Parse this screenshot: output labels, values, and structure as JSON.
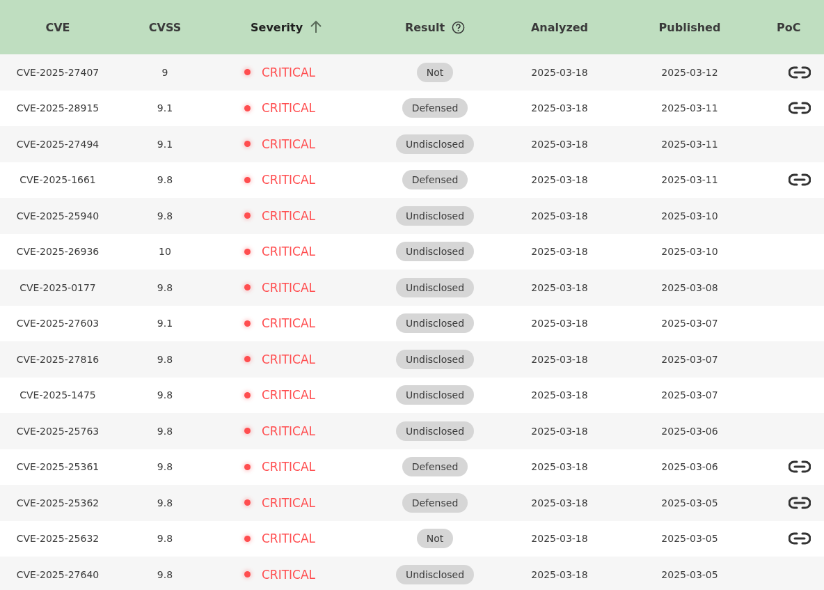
{
  "table": {
    "columns": [
      {
        "label": "CVE",
        "kind": "plain"
      },
      {
        "label": "CVSS",
        "kind": "plain"
      },
      {
        "label": "Severity",
        "kind": "sorted-asc"
      },
      {
        "label": "Result",
        "kind": "help"
      },
      {
        "label": "Analyzed",
        "kind": "plain"
      },
      {
        "label": "Published",
        "kind": "plain"
      },
      {
        "label": "PoC",
        "kind": "plain"
      }
    ],
    "rows": [
      {
        "cve": "CVE-2025-27407",
        "cvss": "9",
        "severity": "CRITICAL",
        "result": "Not",
        "analyzed": "2025-03-18",
        "published": "2025-03-12",
        "poc": true
      },
      {
        "cve": "CVE-2025-28915",
        "cvss": "9.1",
        "severity": "CRITICAL",
        "result": "Defensed",
        "analyzed": "2025-03-18",
        "published": "2025-03-11",
        "poc": true
      },
      {
        "cve": "CVE-2025-27494",
        "cvss": "9.1",
        "severity": "CRITICAL",
        "result": "Undisclosed",
        "analyzed": "2025-03-18",
        "published": "2025-03-11",
        "poc": false
      },
      {
        "cve": "CVE-2025-1661",
        "cvss": "9.8",
        "severity": "CRITICAL",
        "result": "Defensed",
        "analyzed": "2025-03-18",
        "published": "2025-03-11",
        "poc": true
      },
      {
        "cve": "CVE-2025-25940",
        "cvss": "9.8",
        "severity": "CRITICAL",
        "result": "Undisclosed",
        "analyzed": "2025-03-18",
        "published": "2025-03-10",
        "poc": false
      },
      {
        "cve": "CVE-2025-26936",
        "cvss": "10",
        "severity": "CRITICAL",
        "result": "Undisclosed",
        "analyzed": "2025-03-18",
        "published": "2025-03-10",
        "poc": false
      },
      {
        "cve": "CVE-2025-0177",
        "cvss": "9.8",
        "severity": "CRITICAL",
        "result": "Undisclosed",
        "analyzed": "2025-03-18",
        "published": "2025-03-08",
        "poc": false
      },
      {
        "cve": "CVE-2025-27603",
        "cvss": "9.1",
        "severity": "CRITICAL",
        "result": "Undisclosed",
        "analyzed": "2025-03-18",
        "published": "2025-03-07",
        "poc": false
      },
      {
        "cve": "CVE-2025-27816",
        "cvss": "9.8",
        "severity": "CRITICAL",
        "result": "Undisclosed",
        "analyzed": "2025-03-18",
        "published": "2025-03-07",
        "poc": false
      },
      {
        "cve": "CVE-2025-1475",
        "cvss": "9.8",
        "severity": "CRITICAL",
        "result": "Undisclosed",
        "analyzed": "2025-03-18",
        "published": "2025-03-07",
        "poc": false
      },
      {
        "cve": "CVE-2025-25763",
        "cvss": "9.8",
        "severity": "CRITICAL",
        "result": "Undisclosed",
        "analyzed": "2025-03-18",
        "published": "2025-03-06",
        "poc": false
      },
      {
        "cve": "CVE-2025-25361",
        "cvss": "9.8",
        "severity": "CRITICAL",
        "result": "Defensed",
        "analyzed": "2025-03-18",
        "published": "2025-03-06",
        "poc": true
      },
      {
        "cve": "CVE-2025-25362",
        "cvss": "9.8",
        "severity": "CRITICAL",
        "result": "Defensed",
        "analyzed": "2025-03-18",
        "published": "2025-03-05",
        "poc": true
      },
      {
        "cve": "CVE-2025-25632",
        "cvss": "9.8",
        "severity": "CRITICAL",
        "result": "Not",
        "analyzed": "2025-03-18",
        "published": "2025-03-05",
        "poc": true
      },
      {
        "cve": "CVE-2025-27640",
        "cvss": "9.8",
        "severity": "CRITICAL",
        "result": "Undisclosed",
        "analyzed": "2025-03-18",
        "published": "2025-03-05",
        "poc": false
      }
    ]
  }
}
